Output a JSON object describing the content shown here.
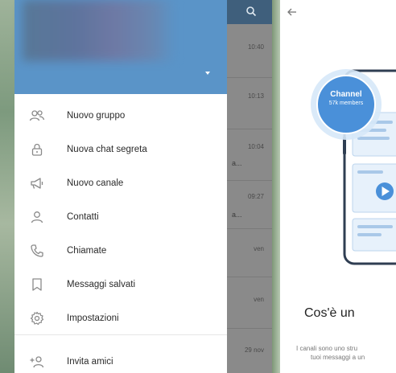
{
  "chat_list": {
    "times": [
      "10:40",
      "10:13",
      "10:04",
      "09:27",
      "ven",
      "ven",
      "29 nov"
    ],
    "snippets": [
      "a...",
      "a..."
    ]
  },
  "drawer": {
    "menu": [
      {
        "label": "Nuovo gruppo",
        "icon": "group-icon"
      },
      {
        "label": "Nuova chat segreta",
        "icon": "lock-icon"
      },
      {
        "label": "Nuovo canale",
        "icon": "megaphone-icon"
      },
      {
        "label": "Contatti",
        "icon": "person-icon"
      },
      {
        "label": "Chiamate",
        "icon": "phone-icon"
      },
      {
        "label": "Messaggi salvati",
        "icon": "bookmark-icon"
      },
      {
        "label": "Impostazioni",
        "icon": "gear-icon"
      },
      {
        "label": "Invita amici",
        "icon": "add-person-icon"
      }
    ]
  },
  "channel_intro": {
    "badge_title": "Channel",
    "badge_subtitle": "57k members",
    "title": "Cos'è un",
    "text_line1": "I canali sono uno stru",
    "text_line2": "tuoi messaggi a un"
  },
  "colors": {
    "header_blue": "#5a94c8",
    "toolbar_dark": "#3f5f7c",
    "illustration_blue": "#4a90d9"
  }
}
